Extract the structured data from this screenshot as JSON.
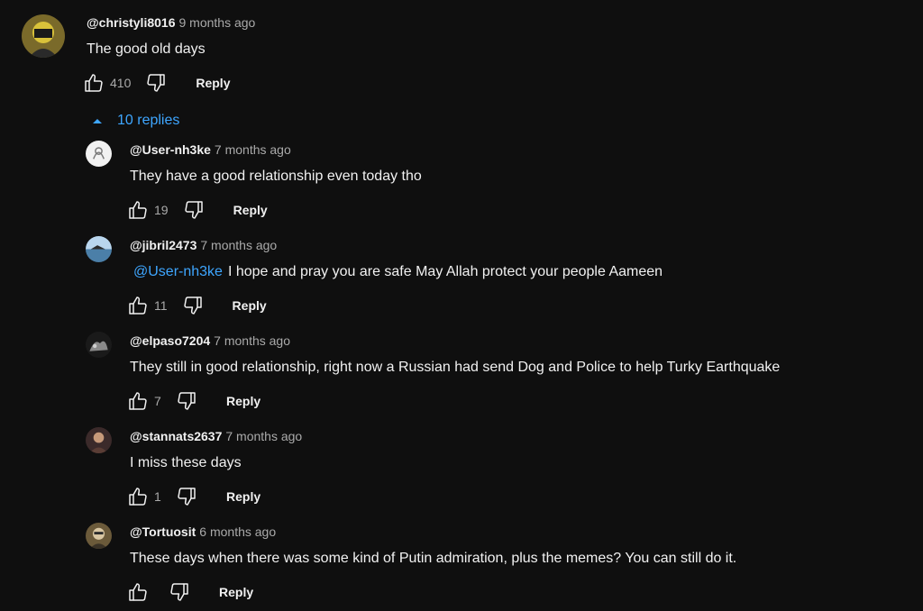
{
  "thread": {
    "top_comment": {
      "author": "@christyli8016",
      "time": "9 months ago",
      "text": "The good old days",
      "likes": "410",
      "reply_label": "Reply"
    },
    "replies_toggle": {
      "label": "10 replies",
      "icon": "caret-up-icon"
    },
    "replies": [
      {
        "author": "@User-nh3ke",
        "time": "7 months ago",
        "text": "They have a good relationship even today tho",
        "likes": "19",
        "reply_label": "Reply"
      },
      {
        "author": "@jibril2473",
        "time": "7 months ago",
        "mention": "@User-nh3ke",
        "text": "I hope and pray you are safe May Allah protect your people Aameen",
        "likes": "11",
        "reply_label": "Reply"
      },
      {
        "author": "@elpaso7204",
        "time": "7 months ago",
        "text": "They still in good relationship, right now a Russian had send Dog and Police to help Turky Earthquake",
        "likes": "7",
        "reply_label": "Reply"
      },
      {
        "author": "@stannats2637",
        "time": "7 months ago",
        "text": "I miss these days",
        "likes": "1",
        "reply_label": "Reply"
      },
      {
        "author": "@Tortuosit",
        "time": "6 months ago",
        "text": "These days when there was some kind of Putin admiration, plus the memes? You can still do it.",
        "likes": "",
        "reply_label": "Reply"
      }
    ]
  },
  "colors": {
    "background": "#0f0f0f",
    "text": "#f1f1f1",
    "muted": "#aaaaaa",
    "link": "#3ea6ff"
  }
}
